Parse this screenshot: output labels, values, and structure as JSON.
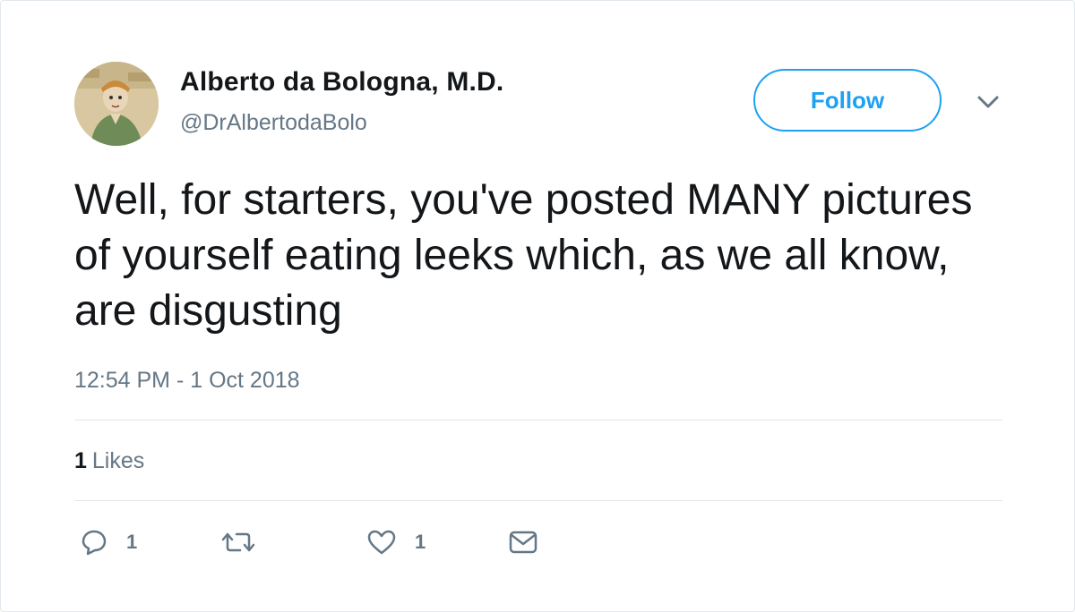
{
  "author": {
    "name": "Alberto da Bologna, M.D.",
    "handle": "@DrAlbertodaBolo",
    "avatar_icon": "avatar-portrait"
  },
  "follow_label": "Follow",
  "more_icon": "chevron-down-icon",
  "tweet": {
    "text": "Well, for starters, you've posted MANY pictures of yourself eating leeks which, as we all know, are disgusting",
    "timestamp": "12:54 PM - 1 Oct 2018"
  },
  "stats": {
    "likes_count": "1",
    "likes_label": "Likes"
  },
  "actions": {
    "reply_count": "1",
    "like_count": "1"
  },
  "colors": {
    "accent": "#1da1f2",
    "text": "#14171a",
    "secondary": "#657786",
    "divider": "#e1e8ed"
  }
}
